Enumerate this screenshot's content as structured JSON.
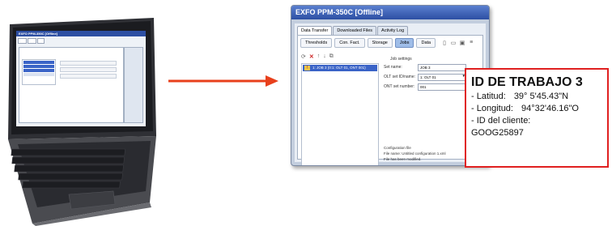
{
  "app": {
    "title": "EXFO PPM-350C [Offline]",
    "tabs": [
      "Data Transfer",
      "Downloaded Files",
      "Activity Log"
    ],
    "subtabs": [
      "Thresholds",
      "Con. Fact.",
      "Storage",
      "Jobs",
      "Data"
    ],
    "active_subtab": "Jobs",
    "job_row": "1: JOB 3 (0:1: OLT 01, ONT 001)",
    "settings_title": "Job settings",
    "fields": [
      {
        "label": "Set name:",
        "value": "JOB 3"
      },
      {
        "label": "OLT set ID/name:",
        "value": "1: OLT 01"
      },
      {
        "label": "ONT set number:",
        "value": "001"
      }
    ],
    "config_lines": [
      "Configuration file",
      "File name: Untitled configuration 1.xml",
      "File has been modified."
    ]
  },
  "laptop_screen": {
    "title": "EXFO PPM-350C [Offline]"
  },
  "card": {
    "title": "ID DE TRABAJO 3",
    "latitude_label": "- Latitud:",
    "latitude_value": "39° 5'45.43\"N",
    "longitude_label": "- Longitud:",
    "longitude_value": "94°32'46.16\"O",
    "client_label": "- ID del cliente:",
    "client_value": "GOOG25897"
  },
  "colors": {
    "accent_red": "#e02020",
    "title_blue": "#2d4fa3",
    "selection_blue": "#3a63c7"
  },
  "icons": [
    "laptop-icon",
    "arrow-right-icon",
    "refresh-icon",
    "delete-icon",
    "new-file-icon",
    "open-folder-icon",
    "save-icon",
    "warning-icon"
  ]
}
